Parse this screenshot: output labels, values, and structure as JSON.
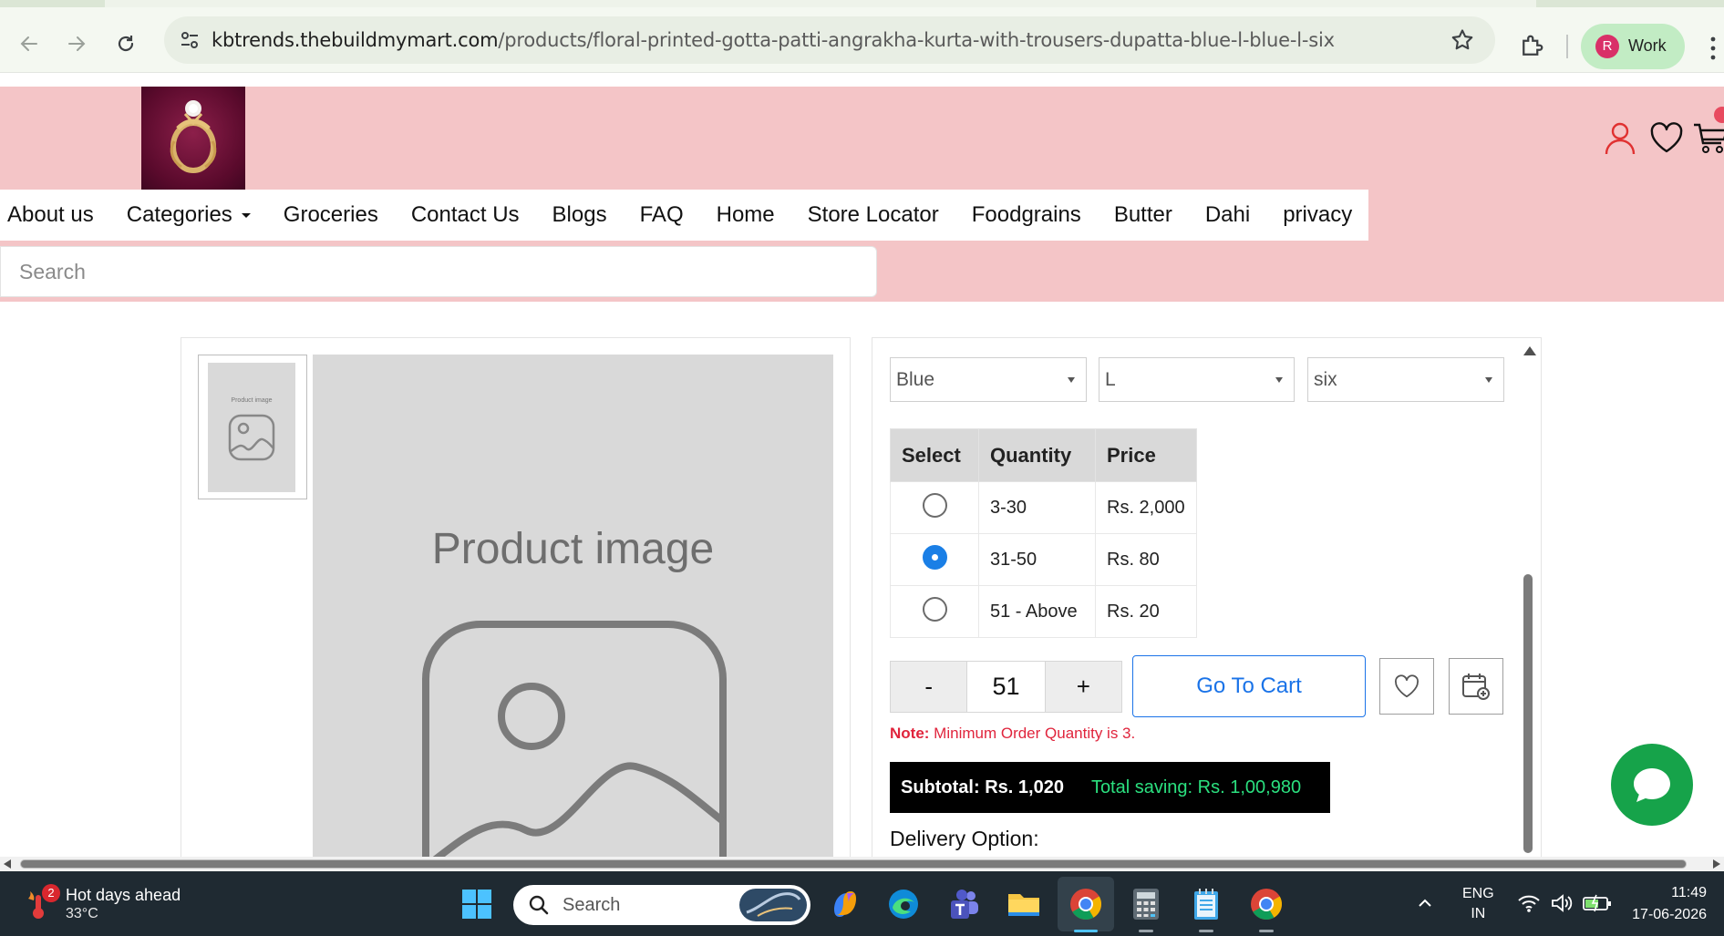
{
  "browser": {
    "url_host": "kbtrends.thebuildmymart.com",
    "url_path": "/products/floral-printed-gotta-patti-angrakha-kurta-with-trousers-dupatta-blue-l-blue-l-six",
    "profile_initial": "R",
    "profile_label": "Work"
  },
  "site": {
    "nav": [
      "About us",
      "Categories",
      "Groceries",
      "Contact Us",
      "Blogs",
      "FAQ",
      "Home",
      "Store Locator",
      "Foodgrains",
      "Butter",
      "Dahi",
      "privacy"
    ],
    "search_placeholder": "Search"
  },
  "gallery": {
    "thumb_label": "Product image",
    "main_label": "Product image"
  },
  "product": {
    "color": "Blue",
    "size": "L",
    "variant": "six",
    "table_headers": {
      "select": "Select",
      "quantity": "Quantity",
      "price": "Price"
    },
    "tiers": [
      {
        "quantity": "3-30",
        "price": "Rs. 2,000",
        "selected": false
      },
      {
        "quantity": "31-50",
        "price": "Rs. 80",
        "selected": true
      },
      {
        "quantity": "51 - Above",
        "price": "Rs. 20",
        "selected": false
      }
    ],
    "qty_minus": "-",
    "qty_value": "51",
    "qty_plus": "+",
    "go_to_cart": "Go To Cart",
    "note_label": "Note:",
    "note_text": " Minimum Order Quantity is 3.",
    "subtotal": "Subtotal: Rs. 1,020",
    "total_saving": "Total saving: Rs. 1,00,980",
    "delivery_label": "Delivery Option:"
  },
  "taskbar": {
    "weather_badge": "2",
    "weather_title": "Hot days ahead",
    "weather_temp": "33°C",
    "search_label": "Search",
    "lang_1": "ENG",
    "lang_2": "IN",
    "time": "11:49",
    "date": "17-06-2026"
  },
  "colors": {
    "header_bg": "#f4c5c7",
    "accent_blue": "#1a73e8",
    "note_red": "#e0243c",
    "saving_green": "#2be07f",
    "chat_green": "#16a34a"
  }
}
